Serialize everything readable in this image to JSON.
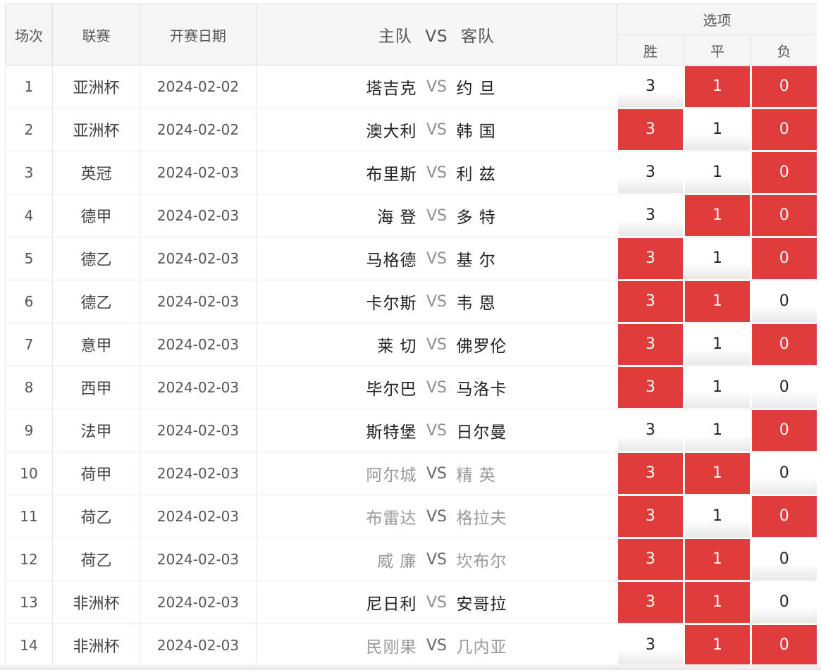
{
  "header": {
    "num": "场次",
    "league": "联赛",
    "date": "开赛日期",
    "match_home": "主队",
    "match_vs": "VS",
    "match_away": "客队",
    "options": "选项",
    "win": "胜",
    "draw": "平",
    "lose": "负"
  },
  "colors": {
    "selected": "#e03c3c",
    "vs_gray": "#8e8e8e"
  },
  "rows": [
    {
      "num": "1",
      "league": "亚洲杯",
      "date": "2024-02-02",
      "home": "塔吉克",
      "vs": "VS",
      "away": "约 旦",
      "dim": false,
      "win": "3",
      "draw": "1",
      "lose": "0",
      "sel": [
        false,
        true,
        true
      ]
    },
    {
      "num": "2",
      "league": "亚洲杯",
      "date": "2024-02-02",
      "home": "澳大利",
      "vs": "VS",
      "away": "韩 国",
      "dim": false,
      "win": "3",
      "draw": "1",
      "lose": "0",
      "sel": [
        true,
        false,
        true
      ]
    },
    {
      "num": "3",
      "league": "英冠",
      "date": "2024-02-03",
      "home": "布里斯",
      "vs": "VS",
      "away": "利 兹",
      "dim": false,
      "win": "3",
      "draw": "1",
      "lose": "0",
      "sel": [
        false,
        false,
        true
      ]
    },
    {
      "num": "4",
      "league": "德甲",
      "date": "2024-02-03",
      "home": "海 登",
      "vs": "VS",
      "away": "多 特",
      "dim": false,
      "win": "3",
      "draw": "1",
      "lose": "0",
      "sel": [
        false,
        true,
        true
      ]
    },
    {
      "num": "5",
      "league": "德乙",
      "date": "2024-02-03",
      "home": "马格德",
      "vs": "VS",
      "away": "基 尔",
      "dim": false,
      "win": "3",
      "draw": "1",
      "lose": "0",
      "sel": [
        true,
        false,
        true
      ]
    },
    {
      "num": "6",
      "league": "德乙",
      "date": "2024-02-03",
      "home": "卡尔斯",
      "vs": "VS",
      "away": "韦 恩",
      "dim": false,
      "win": "3",
      "draw": "1",
      "lose": "0",
      "sel": [
        true,
        true,
        false
      ]
    },
    {
      "num": "7",
      "league": "意甲",
      "date": "2024-02-03",
      "home": "莱 切",
      "vs": "VS",
      "away": "佛罗伦",
      "dim": false,
      "win": "3",
      "draw": "1",
      "lose": "0",
      "sel": [
        true,
        false,
        true
      ]
    },
    {
      "num": "8",
      "league": "西甲",
      "date": "2024-02-03",
      "home": "毕尔巴",
      "vs": "VS",
      "away": "马洛卡",
      "dim": false,
      "win": "3",
      "draw": "1",
      "lose": "0",
      "sel": [
        true,
        false,
        false
      ]
    },
    {
      "num": "9",
      "league": "法甲",
      "date": "2024-02-03",
      "home": "斯特堡",
      "vs": "VS",
      "away": "日尔曼",
      "dim": false,
      "win": "3",
      "draw": "1",
      "lose": "0",
      "sel": [
        false,
        false,
        true
      ]
    },
    {
      "num": "10",
      "league": "荷甲",
      "date": "2024-02-03",
      "home": "阿尔城",
      "vs": "VS",
      "away": "精 英",
      "dim": true,
      "win": "3",
      "draw": "1",
      "lose": "0",
      "sel": [
        true,
        true,
        false
      ]
    },
    {
      "num": "11",
      "league": "荷乙",
      "date": "2024-02-03",
      "home": "布雷达",
      "vs": "VS",
      "away": "格拉夫",
      "dim": true,
      "win": "3",
      "draw": "1",
      "lose": "0",
      "sel": [
        true,
        false,
        true
      ]
    },
    {
      "num": "12",
      "league": "荷乙",
      "date": "2024-02-03",
      "home": "威 廉",
      "vs": "VS",
      "away": "坎布尔",
      "dim": true,
      "win": "3",
      "draw": "1",
      "lose": "0",
      "sel": [
        true,
        true,
        false
      ]
    },
    {
      "num": "13",
      "league": "非洲杯",
      "date": "2024-02-03",
      "home": "尼日利",
      "vs": "VS",
      "away": "安哥拉",
      "dim": false,
      "win": "3",
      "draw": "1",
      "lose": "0",
      "sel": [
        true,
        true,
        false
      ]
    },
    {
      "num": "14",
      "league": "非洲杯",
      "date": "2024-02-03",
      "home": "民刚果",
      "vs": "VS",
      "away": "几内亚",
      "dim": true,
      "win": "3",
      "draw": "1",
      "lose": "0",
      "sel": [
        false,
        true,
        true
      ]
    }
  ]
}
